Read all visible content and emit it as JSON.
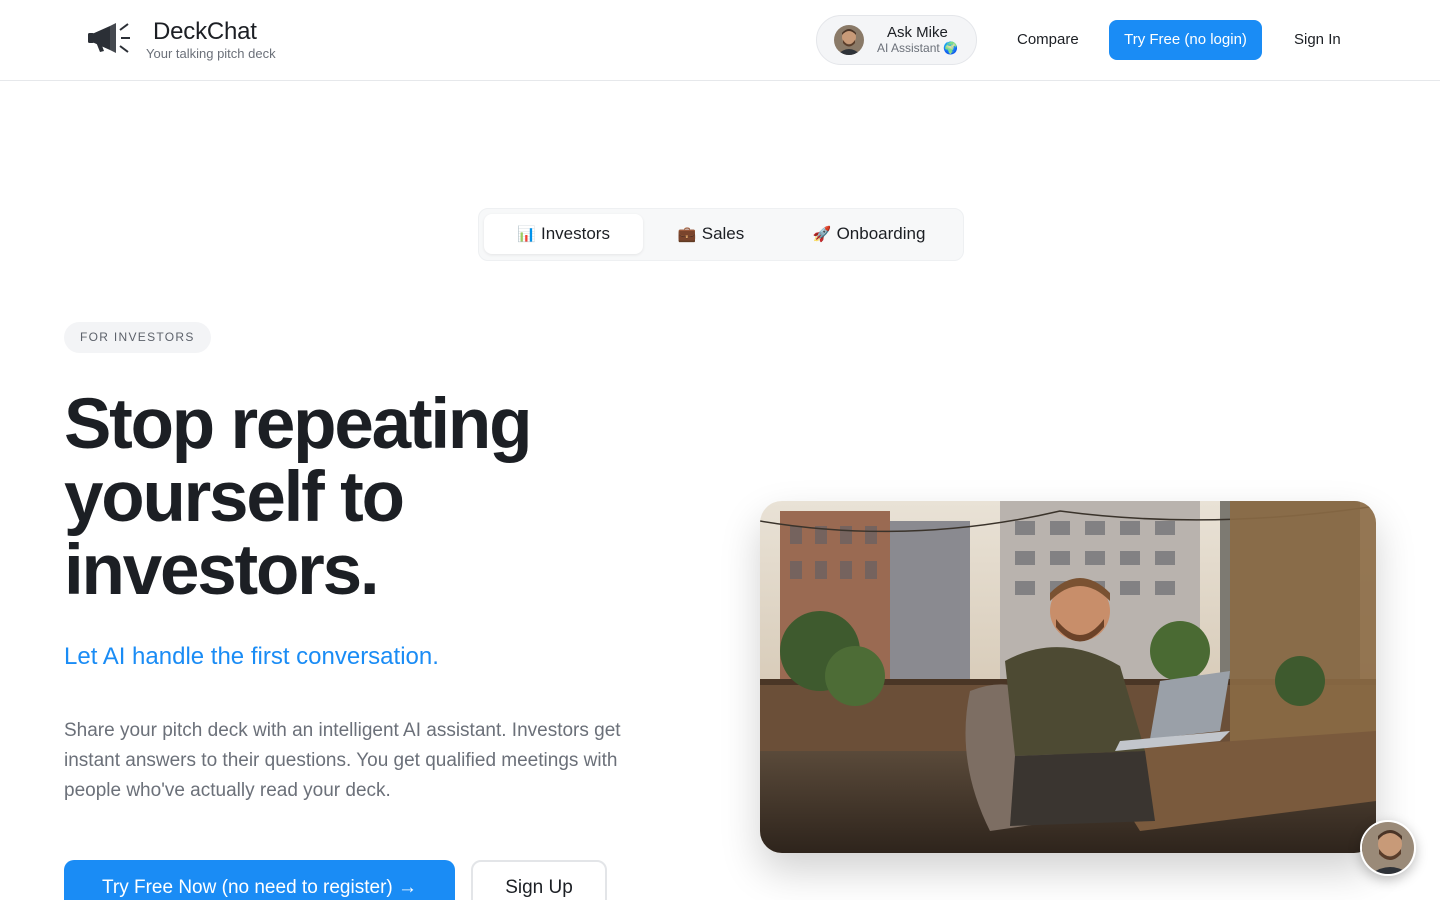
{
  "header": {
    "brand_name": "DeckChat",
    "brand_tagline": "Your talking pitch deck",
    "logo_icon": "megaphone-icon",
    "assistant": {
      "name": "Ask Mike",
      "role": "AI Assistant 🌍"
    },
    "nav": {
      "compare": "Compare",
      "try_free": "Try Free (no login)",
      "sign_in": "Sign In"
    }
  },
  "tabs": [
    {
      "emoji": "📊",
      "label": "Investors",
      "active": true
    },
    {
      "emoji": "💼",
      "label": "Sales",
      "active": false
    },
    {
      "emoji": "🚀",
      "label": "Onboarding",
      "active": false
    }
  ],
  "hero": {
    "eyebrow": "FOR INVESTORS",
    "headline_lines": [
      "Stop repeating",
      "yourself to",
      "investors."
    ],
    "subhead": "Let AI handle the first conversation.",
    "body": "Share your pitch deck with an intelligent AI assistant. Investors get instant answers to their questions. You get qualified meetings with people who've actually read your deck.",
    "cta_primary": "Try Free Now (no need to register) →",
    "cta_secondary": "Sign Up"
  },
  "colors": {
    "accent": "#1a8cf5",
    "text": "#1c1f24",
    "muted": "#6b7079"
  }
}
